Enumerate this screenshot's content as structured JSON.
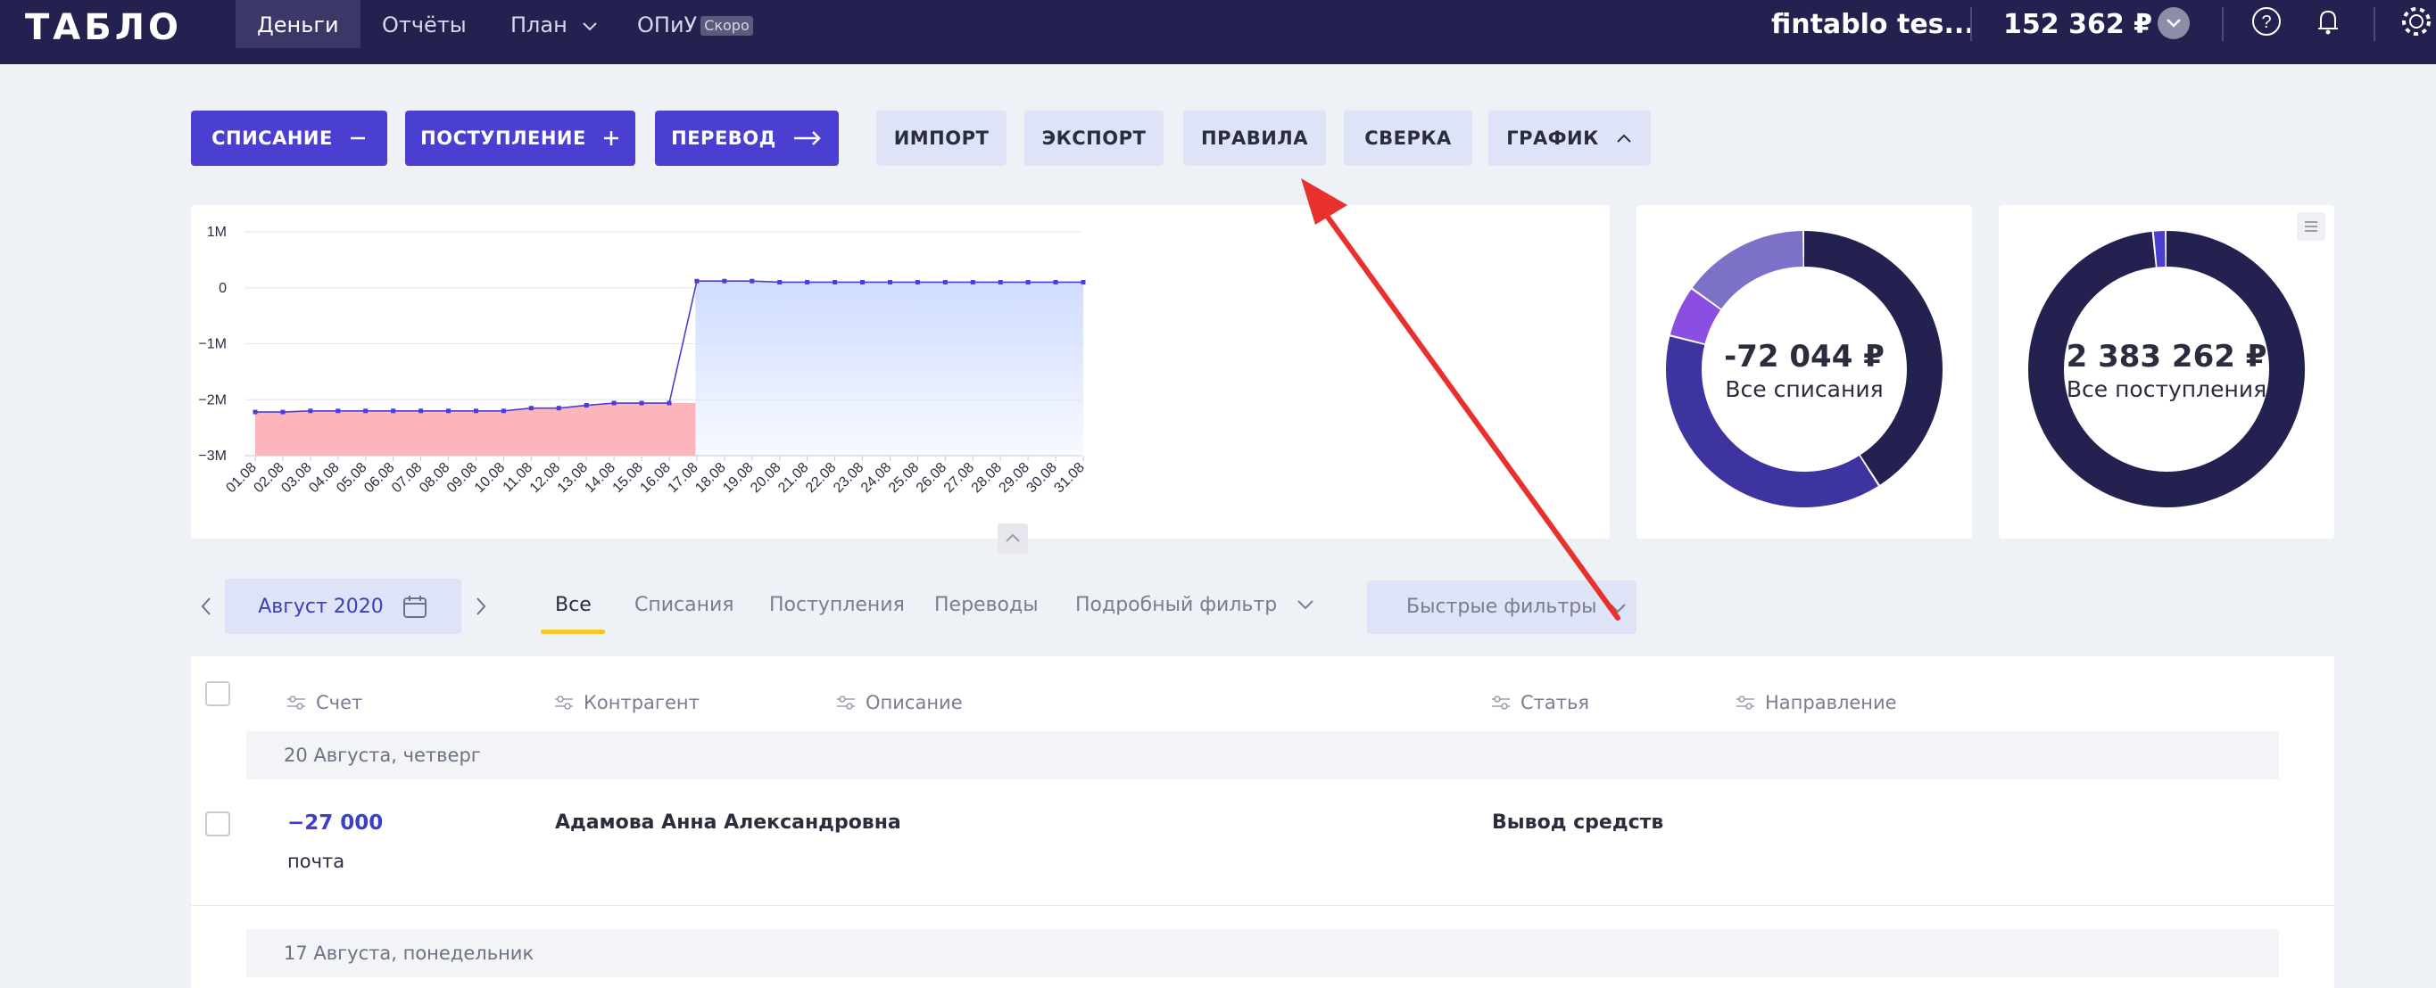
{
  "header": {
    "logo": "ТАБЛО",
    "nav": [
      {
        "label": "Деньги",
        "active": true
      },
      {
        "label": "Отчёты"
      },
      {
        "label": "План"
      },
      {
        "label": "ОПиУ",
        "badge": "Скоро"
      }
    ],
    "company": "fintablo tes...",
    "balance": "152 362 ₽"
  },
  "toolbar": {
    "expense": "СПИСАНИЕ",
    "income": "ПОСТУПЛЕНИЕ",
    "transfer": "ПЕРЕВОД",
    "import": "ИМПОРТ",
    "export": "ЭКСПОРТ",
    "rules": "ПРАВИЛА",
    "reconcile": "СВЕРКА",
    "chart": "ГРАФИК"
  },
  "chart_data": {
    "type": "area",
    "x": [
      "01.08",
      "02.08",
      "03.08",
      "04.08",
      "05.08",
      "06.08",
      "07.08",
      "08.08",
      "09.08",
      "10.08",
      "11.08",
      "12.08",
      "13.08",
      "14.08",
      "15.08",
      "16.08",
      "17.08",
      "18.08",
      "19.08",
      "20.08",
      "21.08",
      "22.08",
      "23.08",
      "24.08",
      "25.08",
      "26.08",
      "27.08",
      "28.08",
      "29.08",
      "30.08",
      "31.08"
    ],
    "series": [
      {
        "values": [
          -2.22,
          -2.22,
          -2.2,
          -2.2,
          -2.2,
          -2.2,
          -2.2,
          -2.2,
          -2.2,
          -2.2,
          -2.15,
          -2.15,
          -2.1,
          -2.06,
          -2.06,
          -2.06,
          0.12,
          0.12,
          0.12,
          0.1,
          0.1,
          0.1,
          0.1,
          0.1,
          0.1,
          0.1,
          0.1,
          0.1,
          0.1,
          0.1,
          0.1
        ]
      }
    ],
    "yticks": [
      "1M",
      "0",
      "−1M",
      "−2M",
      "−3M"
    ],
    "ylim": [
      -3,
      1
    ],
    "negative_color": "#fdb5bb",
    "positive_color": "#cfdcff",
    "line_color": "#4a3fd0"
  },
  "donut_expense": {
    "value": "-72 044 ₽",
    "label": "Все списания",
    "slices": [
      0.41,
      0.38,
      0.06,
      0.15
    ],
    "colors": [
      "#23214f",
      "#3d34a0",
      "#8a4fe0",
      "#7b72c8"
    ]
  },
  "donut_income": {
    "value": "2 383 262 ₽",
    "label": "Все поступления",
    "slices": [
      0.985,
      0.015
    ],
    "colors": [
      "#23214f",
      "#4a3fd0"
    ]
  },
  "filters": {
    "period": "Август 2020",
    "tabs": [
      "Все",
      "Списания",
      "Поступления",
      "Переводы"
    ],
    "detailed": "Подробный фильтр",
    "quick": "Быстрые фильтры"
  },
  "table": {
    "columns": [
      "Счет",
      "Контрагент",
      "Описание",
      "Статья",
      "Направление"
    ],
    "groups": [
      {
        "date": "20 Августа, четверг",
        "rows": [
          {
            "amount": "−27 000",
            "account": "почта",
            "counterparty": "Адамова Анна Александровна",
            "category": "Вывод средств"
          }
        ]
      },
      {
        "date": "17 Августа, понедельник",
        "rows": []
      }
    ]
  },
  "colors": {
    "header_bg": "#23214f",
    "primary": "#4a3fd0",
    "secondary": "#dfe3f8",
    "annotation_arrow": "#e8302c"
  }
}
